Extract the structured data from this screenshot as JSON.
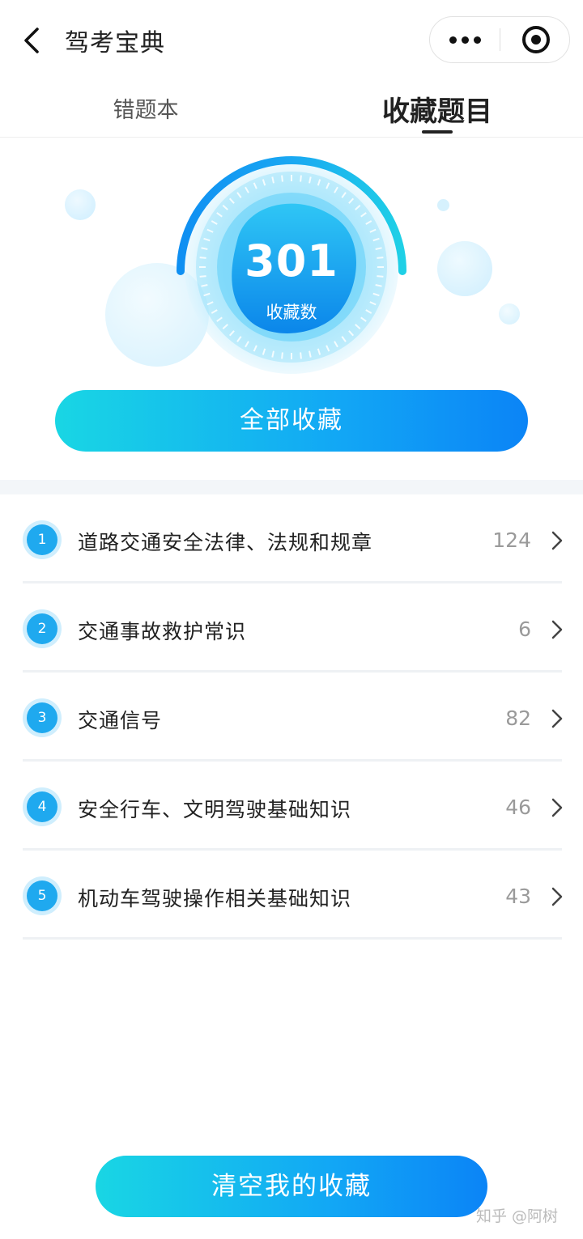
{
  "header": {
    "title": "驾考宝典"
  },
  "tabs": [
    {
      "label": "错题本",
      "active": false
    },
    {
      "label": "收藏题目",
      "active": true
    }
  ],
  "summary": {
    "count": "301",
    "count_label": "收藏数"
  },
  "all_favorites_button": "全部收藏",
  "categories": [
    {
      "index": "1",
      "title": "道路交通安全法律、法规和规章",
      "count": "124"
    },
    {
      "index": "2",
      "title": "交通事故救护常识",
      "count": "6"
    },
    {
      "index": "3",
      "title": "交通信号",
      "count": "82"
    },
    {
      "index": "4",
      "title": "安全行车、文明驾驶基础知识",
      "count": "46"
    },
    {
      "index": "5",
      "title": "机动车驾驶操作相关基础知识",
      "count": "43"
    }
  ],
  "clear_button": "清空我的收藏",
  "watermark": "知乎 @阿树",
  "colors": {
    "accent_start": "#19d6e4",
    "accent_end": "#0b84f6",
    "badge": "#1fa9ef"
  },
  "icons": {
    "back": "chevron-left-icon",
    "more": "more-dots-icon",
    "close": "target-circle-icon",
    "row_arrow": "chevron-right-icon"
  }
}
